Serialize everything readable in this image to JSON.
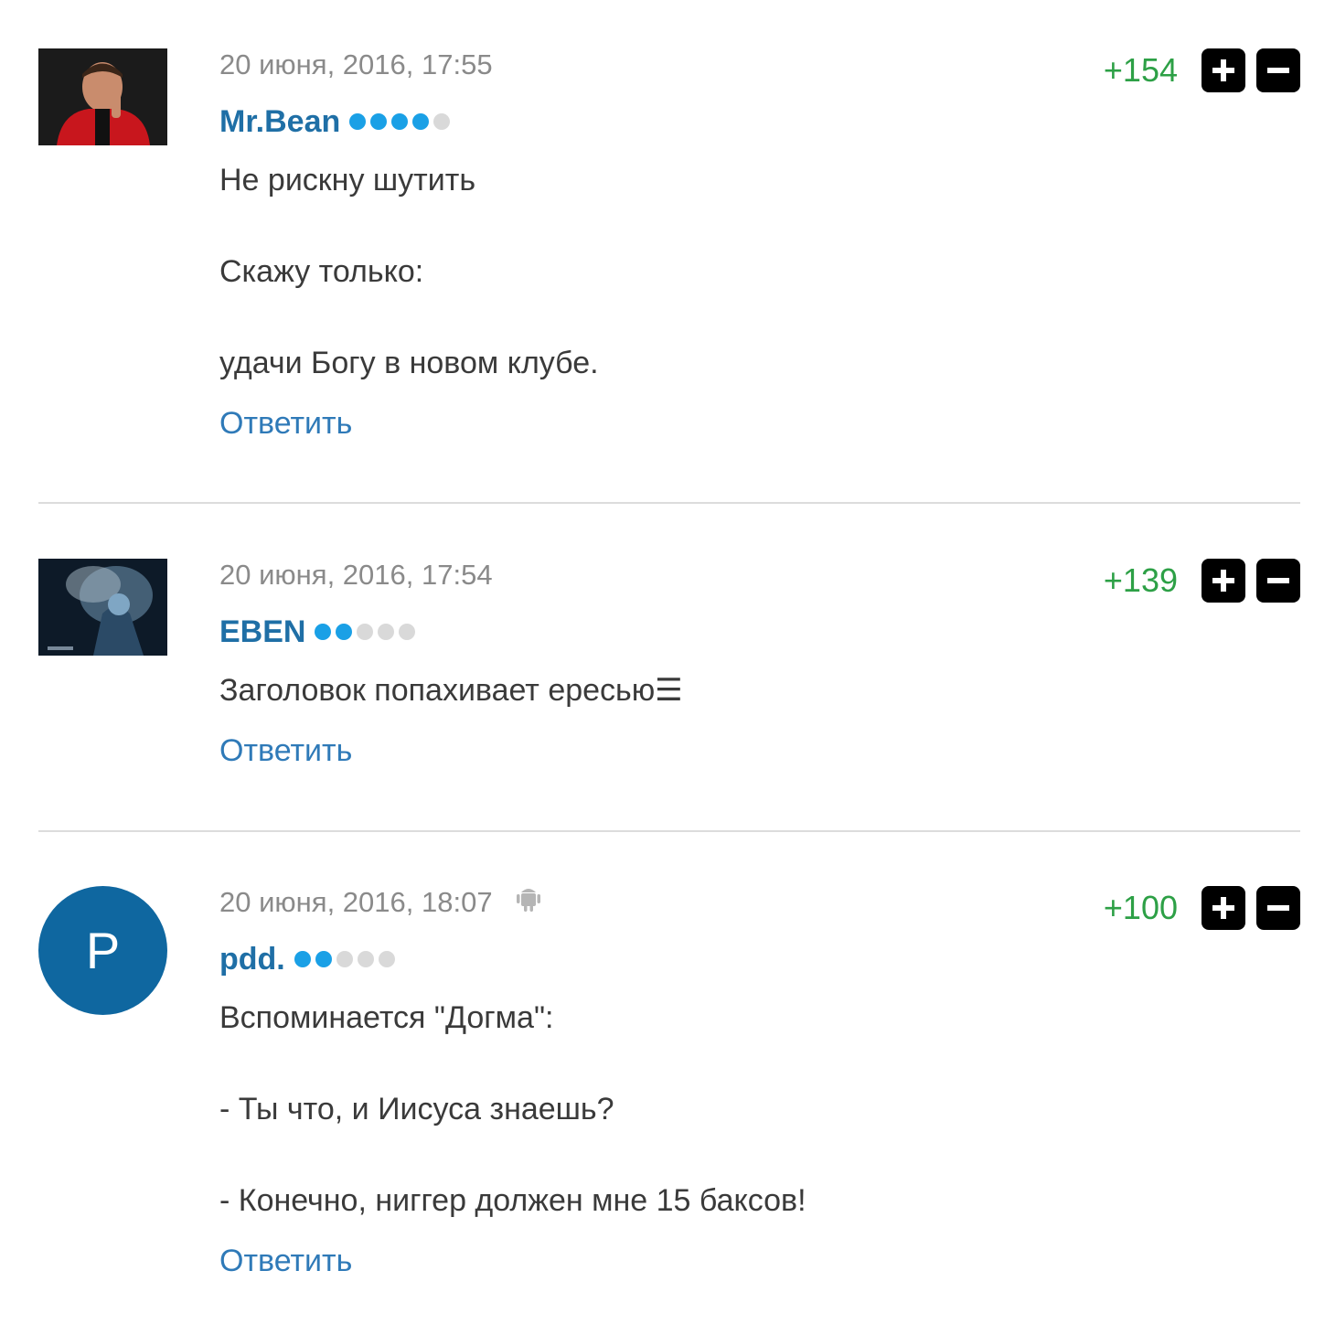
{
  "comments": [
    {
      "timestamp": "20 июня, 2016, 17:55",
      "author": "Mr.Bean",
      "rating_level": 4,
      "score": "+154",
      "lines": [
        "Не рискну шутить",
        "Скажу только:",
        "удачи Богу в новом клубе."
      ],
      "reply_label": "Ответить"
    },
    {
      "timestamp": "20 июня, 2016, 17:54",
      "author": "EBEN",
      "rating_level": 2,
      "score": "+139",
      "lines": [
        "Заголовок попахивает ересью☰"
      ],
      "reply_label": "Ответить"
    },
    {
      "timestamp": "20 июня, 2016, 18:07",
      "author": "pdd.",
      "avatar_letter": "P",
      "device_icon": "android-icon",
      "rating_level": 2,
      "score": "+100",
      "lines": [
        "Вспоминается \"Догма\":",
        "- Ты что, и Иисуса знаешь?",
        "- Конечно, ниггер должен мне 15 баксов!"
      ],
      "reply_label": "Ответить"
    }
  ],
  "colors": {
    "author": "#1f6fa6",
    "reply_link": "#2f7ab8",
    "score": "#2da046",
    "rating_on": "#1aa0e6",
    "rating_off": "#d9d9d9",
    "avatar_bg": "#0f67a0"
  }
}
